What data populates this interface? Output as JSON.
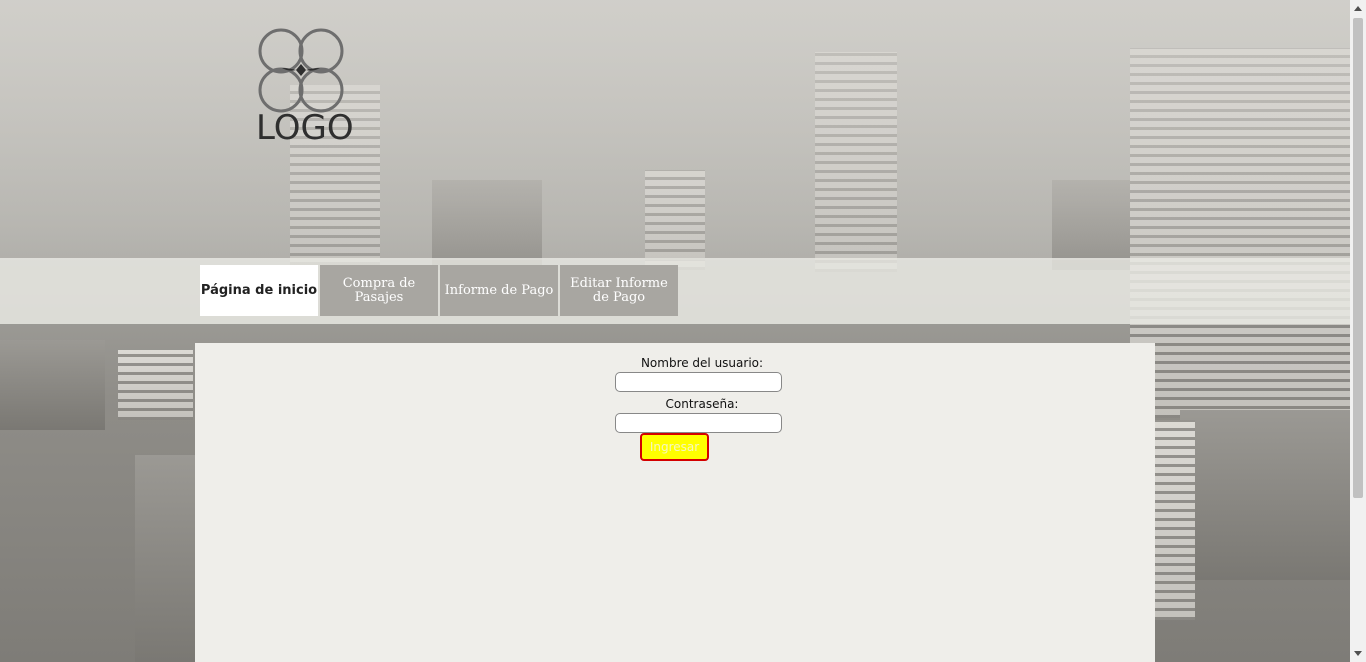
{
  "logo": {
    "text": "LOGO"
  },
  "nav": {
    "items": [
      {
        "label": "Página de inicio",
        "active": true
      },
      {
        "label": "Compra de Pasajes",
        "active": false
      },
      {
        "label": "Informe de Pago",
        "active": false
      },
      {
        "label": "Editar Informe de Pago",
        "active": false
      }
    ]
  },
  "login": {
    "username_label": "Nombre del usuario:",
    "username_value": "",
    "password_label": "Contraseña:",
    "password_value": "",
    "submit_label": "Ingresar"
  },
  "colors": {
    "submit_bg": "#ffff00",
    "submit_border": "#d40000",
    "nav_inactive": "#a8a6a1",
    "nav_active": "#ffffff",
    "content_bg": "#efeeea"
  }
}
